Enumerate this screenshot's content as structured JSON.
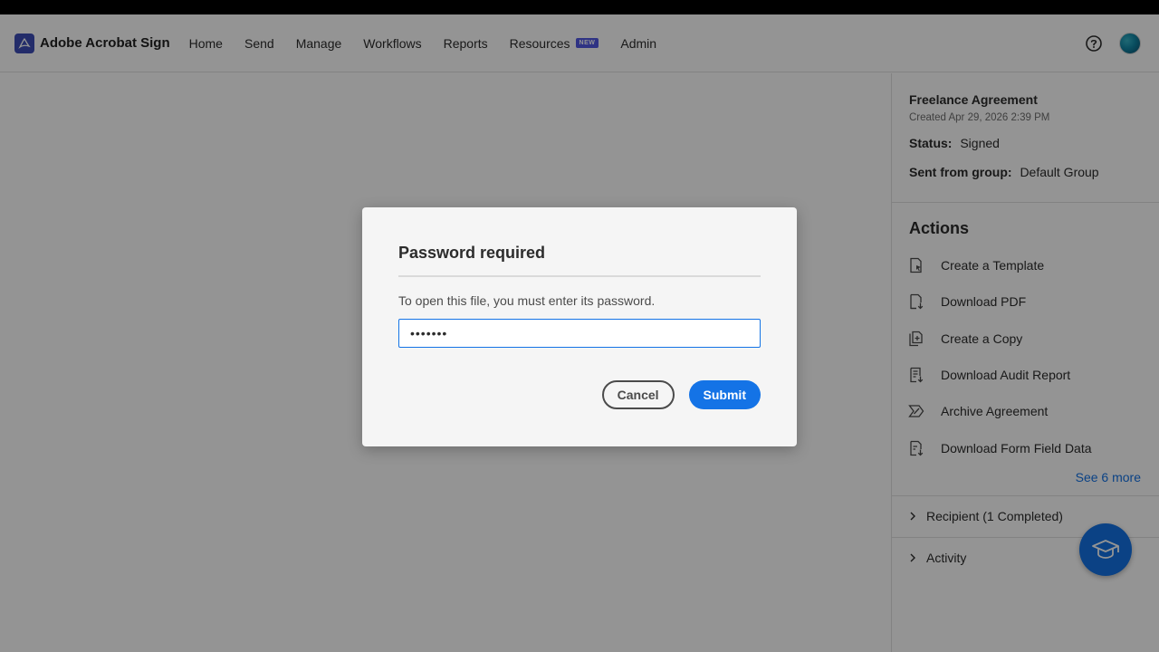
{
  "header": {
    "brand_name": "Adobe Acrobat Sign",
    "nav": [
      {
        "label": "Home"
      },
      {
        "label": "Send"
      },
      {
        "label": "Manage"
      },
      {
        "label": "Workflows"
      },
      {
        "label": "Reports"
      },
      {
        "label": "Resources",
        "badge": "NEW"
      },
      {
        "label": "Admin"
      }
    ],
    "help_icon": "help-circle-icon",
    "avatar_icon": "user-avatar"
  },
  "sidebar": {
    "agreement_title": "Freelance Agreement",
    "created": "Created Apr 29, 2026 2:39 PM",
    "status_label": "Status:",
    "status_value": "Signed",
    "group_label": "Sent from group:",
    "group_value": "Default Group",
    "actions_title": "Actions",
    "actions": [
      {
        "label": "Create a Template",
        "icon": "template-icon"
      },
      {
        "label": "Download PDF",
        "icon": "download-pdf-icon"
      },
      {
        "label": "Create a Copy",
        "icon": "copy-icon"
      },
      {
        "label": "Download Audit Report",
        "icon": "audit-report-icon"
      },
      {
        "label": "Archive Agreement",
        "icon": "archive-icon"
      },
      {
        "label": "Download Form Field Data",
        "icon": "form-data-icon"
      }
    ],
    "see_more": "See 6 more",
    "recipient_section": "Recipient (1 Completed)",
    "activity_section": "Activity"
  },
  "dialog": {
    "title": "Password required",
    "message": "To open this file, you must enter its password.",
    "password_value": "•••••••",
    "cancel_label": "Cancel",
    "submit_label": "Submit"
  },
  "colors": {
    "accent": "#1473e6",
    "brand": "#3d4db7",
    "badge": "#5258e4",
    "overlay": "rgba(0,0,0,0.42)"
  }
}
